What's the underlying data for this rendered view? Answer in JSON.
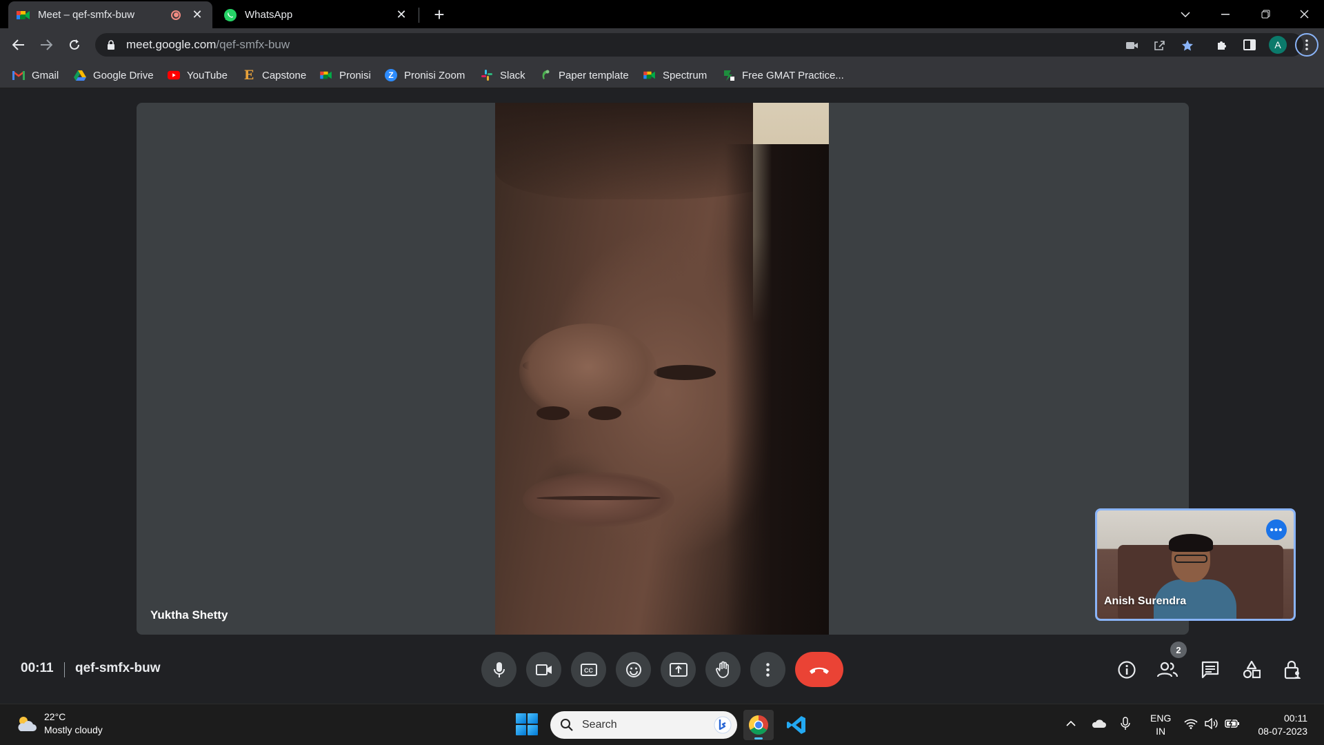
{
  "browser": {
    "tabs": [
      {
        "title": "Meet – qef-smfx-buw",
        "favicon": "google-meet-icon",
        "recording": true,
        "active": true
      },
      {
        "title": "WhatsApp",
        "favicon": "whatsapp-icon",
        "active": false
      }
    ],
    "new_tab_label": "+",
    "url_host": "meet.google.com",
    "url_path": "/qef-smfx-buw",
    "profile_initial": "A"
  },
  "bookmarks": [
    {
      "label": "Gmail",
      "icon": "gmail-icon"
    },
    {
      "label": "Google Drive",
      "icon": "google-drive-icon"
    },
    {
      "label": "YouTube",
      "icon": "youtube-icon"
    },
    {
      "label": "Capstone",
      "icon": "capstone-icon",
      "glyph": "E"
    },
    {
      "label": "Pronisi",
      "icon": "google-meet-icon"
    },
    {
      "label": "Pronisi Zoom",
      "icon": "zoom-icon",
      "glyph": "Z"
    },
    {
      "label": "Slack",
      "icon": "slack-icon"
    },
    {
      "label": "Paper template",
      "icon": "paper-template-icon"
    },
    {
      "label": "Spectrum",
      "icon": "google-meet-icon"
    },
    {
      "label": "Free GMAT Practice...",
      "icon": "gmat-icon"
    }
  ],
  "meet": {
    "main_participant": "Yuktha Shetty",
    "self_participant": "Anish Surendra",
    "elapsed": "00:11",
    "meeting_code": "qef-smfx-buw",
    "participant_count": "2",
    "accent_end_call": "#ea4335",
    "accent_self_border": "#8ab4f8"
  },
  "taskbar": {
    "weather_temp": "22°C",
    "weather_desc": "Mostly cloudy",
    "search_placeholder": "Search",
    "lang_top": "ENG",
    "lang_bottom": "IN",
    "time": "00:11",
    "date": "08-07-2023"
  }
}
